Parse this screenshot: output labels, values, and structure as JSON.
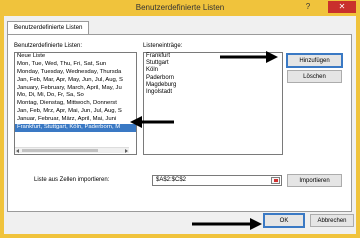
{
  "window": {
    "title": "Benutzerdefinierte Listen",
    "help_glyph": "?",
    "close_glyph": "✕"
  },
  "tab": {
    "label": "Benutzerdefinierte Listen"
  },
  "lists": {
    "label": "Benutzerdefinierte Listen:",
    "items": [
      "Neue Liste",
      "Mon, Tue, Wed, Thu, Fri, Sat, Sun",
      "Monday, Tuesday, Wednesday, Thursda",
      "Jan, Feb, Mar, Apr, May, Jun, Jul, Aug, S",
      "January, February, March, April, May, Ju",
      "Mo, Di, Mi, Do, Fr, Sa, So",
      "Montag, Dienstag, Mittwoch, Donnerst",
      "Jan, Feb, Mrz, Apr, Mai, Jun, Jul, Aug, S",
      "Januar, Februar, März, April, Mai, Juni",
      "Frankfurt, Stuttgart, Köln, Paderborn, M"
    ],
    "selected_index": 9
  },
  "entries": {
    "label": "Listeneinträge:",
    "lines": [
      "Frankfurt",
      "Stuttgart",
      "Köln",
      "Paderborn",
      "Magdeburg",
      "Ingolstadt"
    ]
  },
  "buttons": {
    "add": "Hinzufügen",
    "delete": "Löschen",
    "import": "Importieren",
    "ok": "OK",
    "cancel": "Abbrechen"
  },
  "import": {
    "label": "Liste aus Zellen importieren:",
    "range_value": "$A$2:$C$2"
  },
  "colors": {
    "title_bar": "#f0c33c",
    "selection": "#3a79c4",
    "close_button": "#c9302c"
  }
}
